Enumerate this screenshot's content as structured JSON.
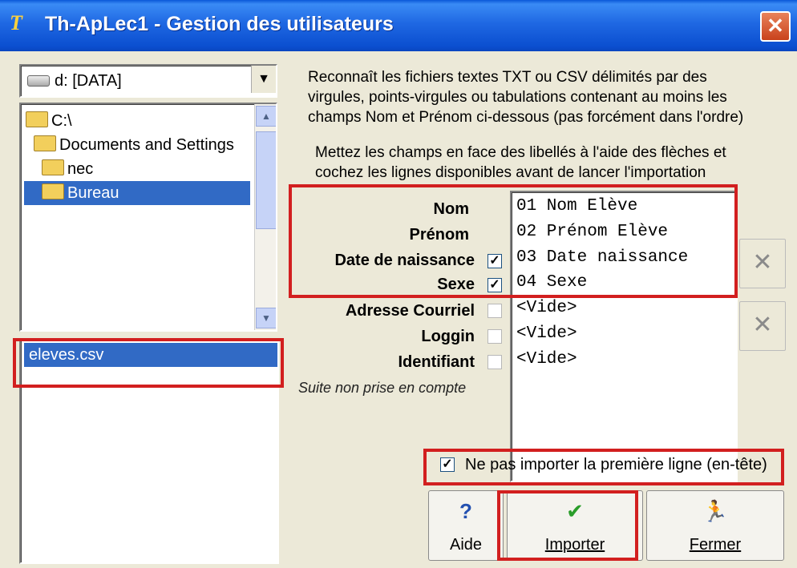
{
  "window": {
    "title": "Th-ApLec1 - Gestion des utilisateurs",
    "app_icon_text": "T",
    "close_label": "✕"
  },
  "drive": {
    "label": "d: [DATA]",
    "dropdown_arrow": "▼"
  },
  "directories": [
    {
      "label": "C:\\",
      "selected": false
    },
    {
      "label": "Documents and Settings",
      "selected": false
    },
    {
      "label": "nec",
      "selected": false
    },
    {
      "label": "Bureau",
      "selected": true
    }
  ],
  "scroll": {
    "up": "▲",
    "down": "▼"
  },
  "files": [
    {
      "label": "eleves.csv",
      "selected": true
    }
  ],
  "info": {
    "line1": "Reconnaît les fichiers textes TXT ou CSV délimités par des",
    "line2": "virgules, points-virgules ou tabulations contenant au moins les",
    "line3": "champs Nom et Prénom ci-dessous (pas forcément dans l'ordre)",
    "line4": "Mettez les champs en face des libellés à l'aide des flèches et",
    "line5": "cochez les lignes disponibles avant de lancer l'importation"
  },
  "fields": [
    {
      "label": "Nom",
      "checkbox": null
    },
    {
      "label": "Prénom",
      "checkbox": null
    },
    {
      "label": "Date de naissance",
      "checkbox": true
    },
    {
      "label": "Sexe",
      "checkbox": true
    },
    {
      "label": "Adresse Courriel",
      "checkbox": false
    },
    {
      "label": "Loggin",
      "checkbox": false
    },
    {
      "label": "Identifiant",
      "checkbox": false
    }
  ],
  "mapping": [
    "01 Nom Elève",
    "02 Prénom Elève",
    "03 Date naissance",
    "04 Sexe",
    "<Vide>",
    "<Vide>",
    "<Vide>"
  ],
  "clear_icon": "✕",
  "note": "Suite non prise en compte",
  "skip_header": {
    "label": "Ne pas importer la première ligne (en-tête)",
    "checked": true,
    "mark": "✓"
  },
  "buttons": {
    "aide": {
      "label": "Aide",
      "icon": "?"
    },
    "importer": {
      "label": "Importer",
      "icon": "✔"
    },
    "fermer": {
      "label": "Fermer",
      "icon": "🏃"
    }
  },
  "colors": {
    "highlight": "#d21f1f",
    "selection": "#316ac5",
    "title_bar": "#0b4fd0",
    "ok_green": "#2a9d2a"
  }
}
